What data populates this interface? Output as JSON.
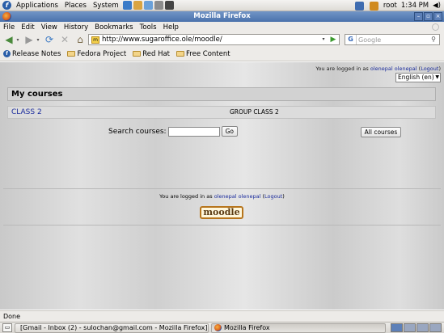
{
  "panel": {
    "applications": "Applications",
    "places": "Places",
    "system": "System",
    "user": "root",
    "time": "1:34 PM"
  },
  "window": {
    "title": "Mozilla Firefox",
    "minimize": "–",
    "maximize": "▫",
    "close": "×"
  },
  "menubar": {
    "items": [
      "File",
      "Edit",
      "View",
      "History",
      "Bookmarks",
      "Tools",
      "Help"
    ]
  },
  "navbar": {
    "url": "http://www.sugaroffice.ole/moodle/",
    "search_placeholder": "Google"
  },
  "bookmarks": {
    "items": [
      "Release Notes",
      "Fedora Project",
      "Red Hat",
      "Free Content"
    ]
  },
  "page": {
    "logged_in_prefix": "You are logged in as",
    "user_name": "olenepal olenepal",
    "logout_open": "(",
    "logout": "Logout",
    "logout_close": ")",
    "language": "English (en)",
    "my_courses": "My courses",
    "course_name": "CLASS 2",
    "course_group": "GROUP CLASS 2",
    "search_label": "Search courses:",
    "go_button": "Go",
    "all_courses_button": "All courses",
    "logo_text": "moodle"
  },
  "statusbar": {
    "text": "Done"
  },
  "taskbar": {
    "tasks": [
      "[Gmail - Inbox (2) - sulochan@gmail.com - Mozilla Firefox]",
      "Mozilla Firefox"
    ]
  },
  "colors": {
    "link": "#1a2b9c",
    "titlebar": "#4a72ac",
    "logo_border": "#b7751c"
  }
}
